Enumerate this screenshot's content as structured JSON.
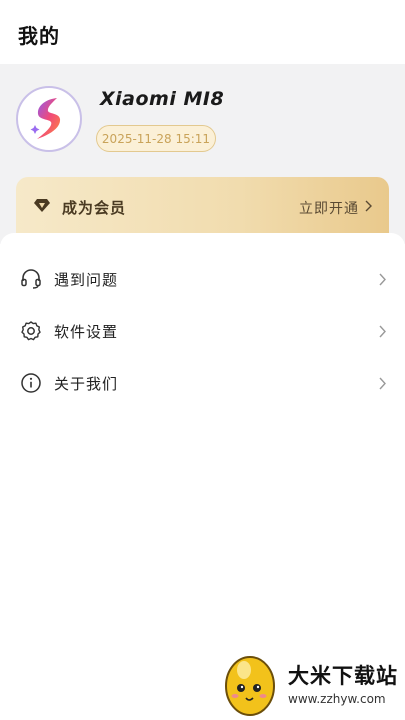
{
  "header": {
    "title": "我的"
  },
  "profile": {
    "device_name": "Xiaomi MI8",
    "date": "2025-11-28 15:11",
    "avatar_icon": "lightning-logo-icon"
  },
  "vip": {
    "icon": "diamond-icon",
    "label": "成为会员",
    "action": "立即开通"
  },
  "menu": {
    "items": [
      {
        "icon": "headset-icon",
        "label": "遇到问题"
      },
      {
        "icon": "gear-icon",
        "label": "软件设置"
      },
      {
        "icon": "info-icon",
        "label": "关于我们"
      }
    ]
  },
  "watermark": {
    "title": "大米下载站",
    "url": "www.zzhyw.com"
  },
  "colors": {
    "vip_gradient_start": "#f6e9c9",
    "vip_gradient_end": "#e9c98c",
    "badge_border": "#e3c98f",
    "badge_text": "#c9a35a",
    "profile_bg": "#f2f2f3"
  }
}
